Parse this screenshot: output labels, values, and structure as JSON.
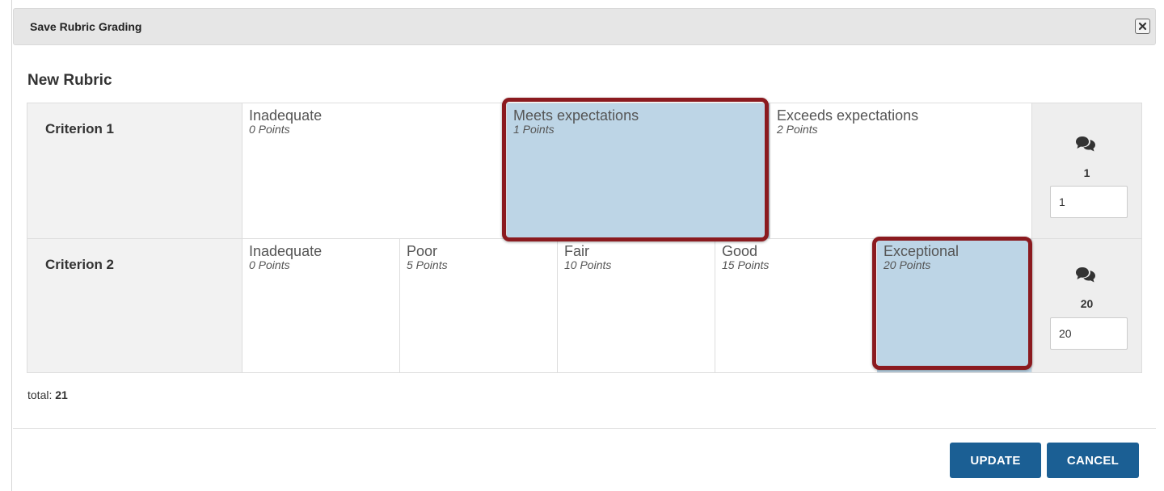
{
  "dialog": {
    "title": "Save Rubric Grading",
    "close_icon": "close-icon"
  },
  "rubric": {
    "title": "New Rubric",
    "criteria": [
      {
        "name": "Criterion 1",
        "ratings": [
          {
            "label": "Inadequate",
            "points": "0 Points",
            "selected": false
          },
          {
            "label": "Meets expectations",
            "points": "1 Points",
            "selected": true
          },
          {
            "label": "Exceeds expectations",
            "points": "2 Points",
            "selected": false
          }
        ],
        "score_display": "1",
        "score_input": "1",
        "comment_icon": "comment-icon"
      },
      {
        "name": "Criterion 2",
        "ratings": [
          {
            "label": "Inadequate",
            "points": "0 Points",
            "selected": false
          },
          {
            "label": "Poor",
            "points": "5 Points",
            "selected": false
          },
          {
            "label": "Fair",
            "points": "10 Points",
            "selected": false
          },
          {
            "label": "Good",
            "points": "15 Points",
            "selected": false
          },
          {
            "label": "Exceptional",
            "points": "20 Points",
            "selected": true
          }
        ],
        "score_display": "20",
        "score_input": "20",
        "comment_icon": "comment-icon"
      }
    ]
  },
  "total": {
    "label": "total:",
    "value": "21"
  },
  "buttons": {
    "update": "UPDATE",
    "cancel": "CANCEL"
  },
  "colors": {
    "primary_button": "#1b5f94",
    "selected_rating": "#bdd5e6",
    "highlight_border": "#8b1a1f"
  }
}
